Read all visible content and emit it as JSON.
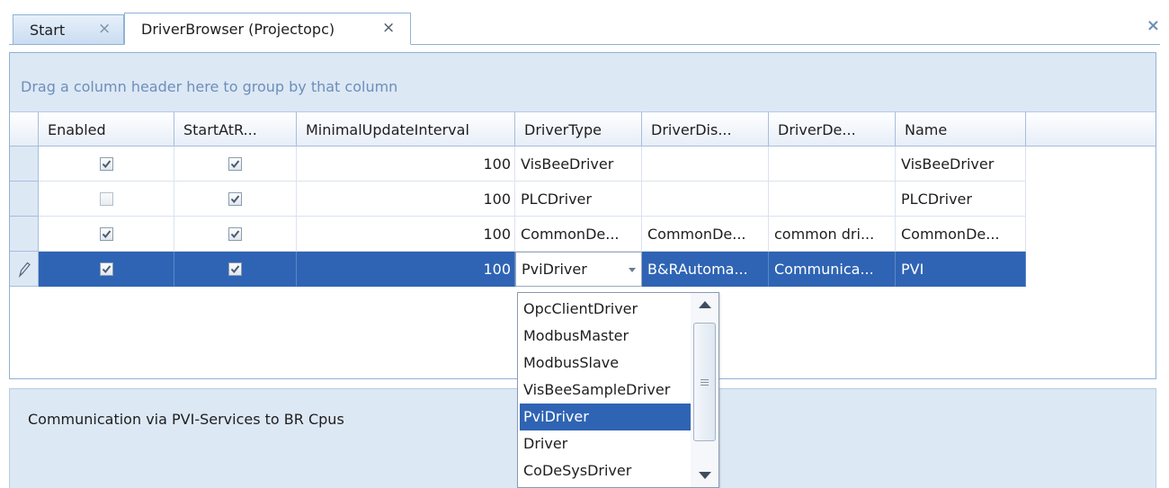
{
  "tabs": {
    "start_label": "Start",
    "driver_label": "DriverBrowser (Projectopc)",
    "close_glyph": "×"
  },
  "grid": {
    "group_hint": "Drag a column header here to group by that column",
    "columns": [
      "Enabled",
      "StartAtR...",
      "MinimalUpdateInterval",
      "DriverType",
      "DriverDis...",
      "DriverDe...",
      "Name"
    ],
    "rows": [
      {
        "enabled": true,
        "start_at_runtime": true,
        "interval": "100",
        "driver_type": "VisBeeDriver",
        "display": "",
        "description": "",
        "name": "VisBeeDriver"
      },
      {
        "enabled": false,
        "start_at_runtime": true,
        "interval": "100",
        "driver_type": "PLCDriver",
        "display": "",
        "description": "",
        "name": "PLCDriver"
      },
      {
        "enabled": true,
        "start_at_runtime": true,
        "interval": "100",
        "driver_type": "CommonDe...",
        "display": "CommonDe...",
        "description": "common dri...",
        "name": "CommonDe..."
      },
      {
        "enabled": true,
        "start_at_runtime": true,
        "interval": "100",
        "driver_type": "PviDriver",
        "display": "B&RAutoma...",
        "description": "Communica...",
        "name": "PVI"
      }
    ],
    "selected_row": 3
  },
  "dropdown": {
    "options": [
      "OpcClientDriver",
      "ModbusMaster",
      "ModbusSlave",
      "VisBeeSampleDriver",
      "PviDriver",
      "Driver",
      "CoDeSysDriver"
    ],
    "selected": "PviDriver"
  },
  "description_text": "Communication via PVI-Services to BR Cpus",
  "colors": {
    "selection": "#2f64b4",
    "panel_bg": "#dde8f5",
    "border": "#8fb2d6",
    "hint_text": "#6c8fb9"
  },
  "icons": {
    "edit_row_indicator": "pencil-icon",
    "tab_close": "close-icon",
    "checkbox": "checkmark-icon"
  }
}
